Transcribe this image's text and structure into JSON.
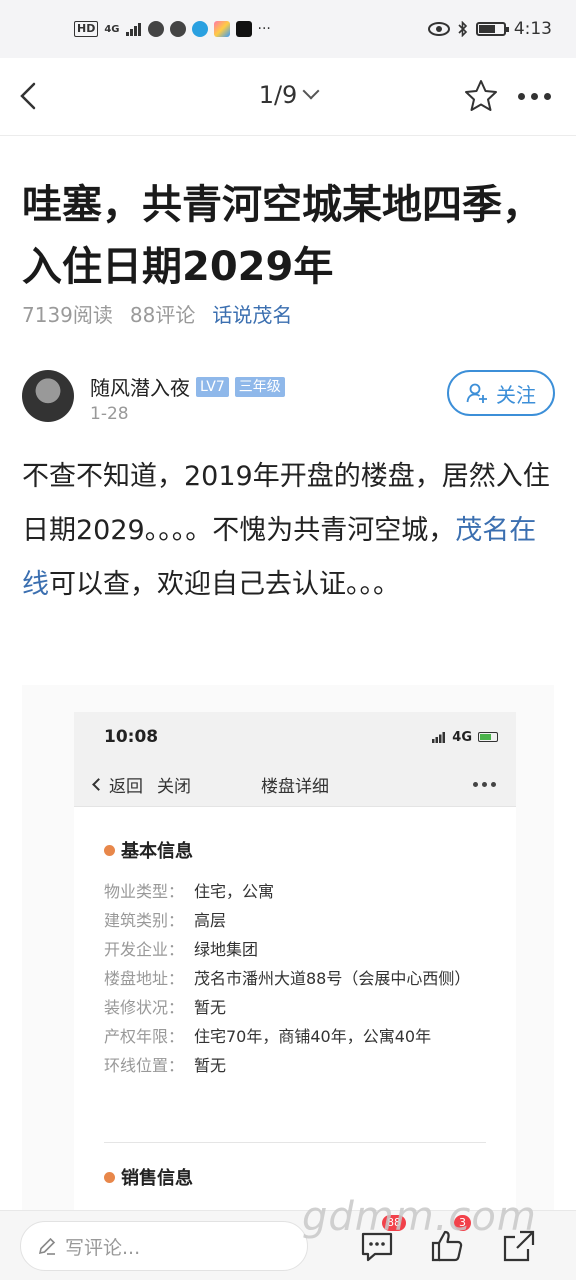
{
  "status_bar": {
    "network_tag": "HD",
    "network_gen": "4G",
    "time": "4:13"
  },
  "nav": {
    "page_indicator": "1/9"
  },
  "article": {
    "title": "哇塞，共青河空城某地四季，入住日期2029年",
    "read_count": "7139阅读",
    "comment_count": "88评论",
    "topic": "话说茂名"
  },
  "author": {
    "name": "随风潜入夜",
    "level": "LV7",
    "grade": "三年级",
    "date": "1-28",
    "follow_label": "关注"
  },
  "body": {
    "text_before": "不查不知道，2019年开盘的楼盘，居然入住日期2029。。。。不愧为共青河空城，",
    "link": "茂名在线",
    "text_after": "可以查，欢迎自己去认证。。。"
  },
  "embedded_screenshot": {
    "time": "10:08",
    "network": "4G",
    "back_label": "返回",
    "close_label": "关闭",
    "page_title": "楼盘详细",
    "section_basic": "基本信息",
    "rows": [
      {
        "key": "物业类型：",
        "value": "住宅，公寓"
      },
      {
        "key": "建筑类别：",
        "value": "高层"
      },
      {
        "key": "开发企业：",
        "value": "绿地集团"
      },
      {
        "key": "楼盘地址：",
        "value": "茂名市潘州大道88号（会展中心西侧）"
      },
      {
        "key": "装修状况：",
        "value": "暂无"
      },
      {
        "key": "产权年限：",
        "value": "住宅70年，商铺40年，公寓40年"
      },
      {
        "key": "环线位置：",
        "value": "暂无"
      }
    ],
    "section_sales": "销售信息"
  },
  "bottom_bar": {
    "comment_placeholder": "写评论...",
    "comment_badge": "88",
    "like_badge": "3"
  },
  "watermark": "gdmm.com",
  "colors": {
    "link": "#3b6fb0",
    "follow": "#3c8fd8",
    "badge_red": "#f2414a",
    "section_dot": "#e8874a"
  }
}
